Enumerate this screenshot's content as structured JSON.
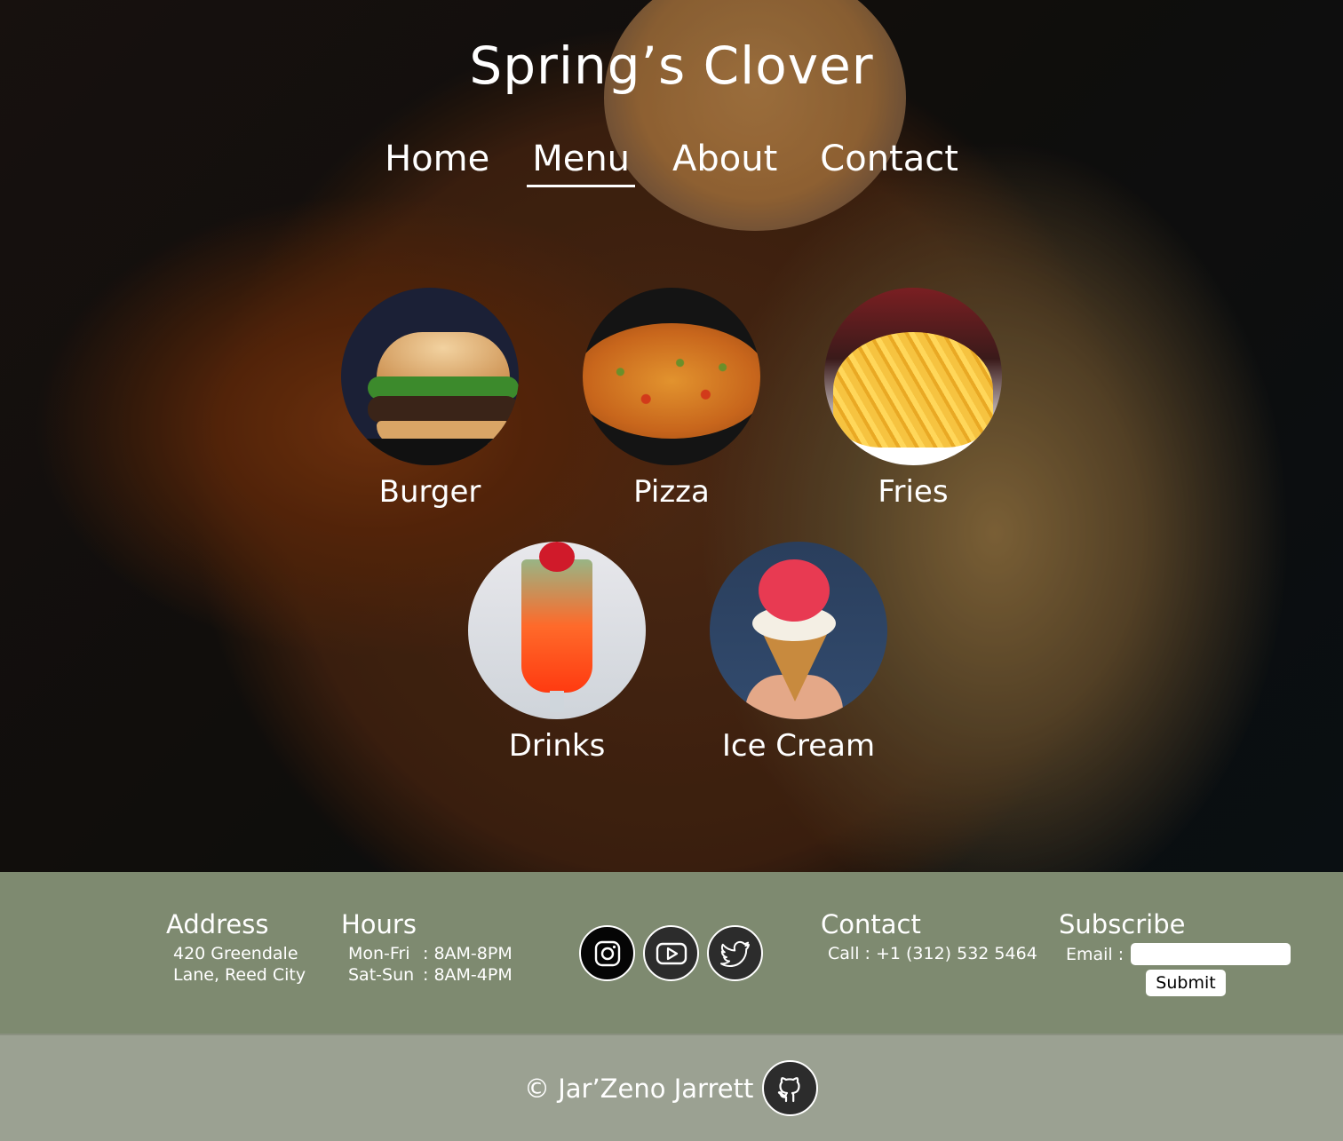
{
  "site": {
    "title": "Spring’s Clover"
  },
  "nav": {
    "items": [
      "Home",
      "Menu",
      "About",
      "Contact"
    ],
    "active": "Menu"
  },
  "menu": {
    "items": [
      {
        "label": "Burger",
        "icon": "burger-image"
      },
      {
        "label": "Pizza",
        "icon": "pizza-image"
      },
      {
        "label": "Fries",
        "icon": "fries-image"
      },
      {
        "label": "Drinks",
        "icon": "drinks-image"
      },
      {
        "label": "Ice Cream",
        "icon": "ice-cream-image"
      }
    ]
  },
  "footer": {
    "address": {
      "heading": "Address",
      "line1": "420 Greendale",
      "line2": "Lane, Reed City"
    },
    "hours": {
      "heading": "Hours",
      "rows": [
        {
          "days": "Mon-Fri",
          "time": ": 8AM-8PM"
        },
        {
          "days": "Sat-Sun",
          "time": ": 8AM-4PM"
        }
      ]
    },
    "social": [
      "instagram-icon",
      "youtube-icon",
      "twitter-icon"
    ],
    "contact": {
      "heading": "Contact",
      "phone": "Call : +1 (312) 532 5464"
    },
    "subscribe": {
      "heading": "Subscribe",
      "email_label": "Email :",
      "email_value": "",
      "submit_label": "Submit"
    }
  },
  "bottom": {
    "copyright": "© Jar’Zeno Jarrett",
    "github_icon": "github-icon"
  },
  "colors": {
    "footer_bg": "#7e8a70",
    "bottom_bg": "#9ba192",
    "text": "#ffffff"
  }
}
